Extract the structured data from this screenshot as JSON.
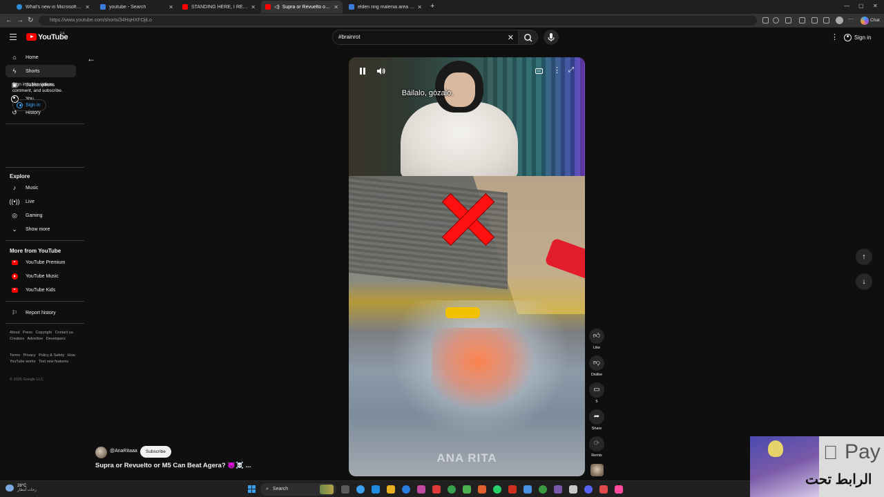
{
  "browser": {
    "tabs": [
      {
        "label": "What's new in Microsoft Edge",
        "active": false,
        "favicon_color": "#2a8fd6"
      },
      {
        "label": "youtube - Search",
        "active": false,
        "favicon_color": "#3b7bd9"
      },
      {
        "label": "STANDING HERE, I REALIZE but i...",
        "active": false,
        "favicon_color": "#ff0000"
      },
      {
        "label": "Supra or Revuelto or M5 Can...",
        "active": true,
        "favicon_color": "#ff0000"
      },
      {
        "label": "elden ring malenia area - Search",
        "active": false,
        "favicon_color": "#3b7bd9"
      }
    ],
    "new_tab": "+",
    "url": "https://www.youtube.com/shorts/34HqHXFOjiLo"
  },
  "yt_header": {
    "logo_text": "YouTube",
    "country_code": "SA",
    "search_query": "#brainrot",
    "sign_in_label": "Sign in"
  },
  "sidebar": {
    "main_items": [
      {
        "label": "Home",
        "icon": "home-icon",
        "active": false
      },
      {
        "label": "Shorts",
        "icon": "shorts-icon",
        "active": true
      },
      {
        "label": "Subscriptions",
        "icon": "subscriptions-icon",
        "active": false
      },
      {
        "label": "You",
        "icon": "you-icon",
        "active": false
      },
      {
        "label": "History",
        "icon": "history-icon",
        "active": false
      }
    ],
    "sign_in_prompt": "Sign in to like videos, comment, and subscribe.",
    "sign_in_button": "Sign in",
    "explore_heading": "Explore",
    "explore_items": [
      {
        "label": "Music",
        "icon": "music-icon"
      },
      {
        "label": "Live",
        "icon": "live-icon"
      },
      {
        "label": "Gaming",
        "icon": "gaming-icon"
      },
      {
        "label": "Show more",
        "icon": "chevron-down-icon"
      }
    ],
    "more_heading": "More from YouTube",
    "more_items": [
      {
        "label": "YouTube Premium",
        "icon": "youtube-premium-icon"
      },
      {
        "label": "YouTube Music",
        "icon": "youtube-music-icon"
      },
      {
        "label": "YouTube Kids",
        "icon": "youtube-kids-icon"
      }
    ],
    "report_history": "Report history",
    "footer_links_1": [
      "About",
      "Press",
      "Copyright",
      "Contact us",
      "Creators",
      "Advertise",
      "Developers"
    ],
    "footer_links_2": [
      "Terms",
      "Privacy",
      "Policy & Safety",
      "How YouTube works",
      "Test new features"
    ],
    "copyright": "© 2026 Google LLC"
  },
  "short": {
    "caption": "Báilalo, gózalo.",
    "watermark": "ANA RITA",
    "channel_name": "@AnaRitaaa",
    "subscribe_label": "Subscribe",
    "title": "Supra or Revuelto or M5 Can Beat Agera? 👿☠️ ...",
    "cc_label": "CC"
  },
  "actions": {
    "like_label": "Like",
    "dislike_label": "Dislike",
    "comment_count": "5",
    "share_label": "Share",
    "remix_label": "Remix"
  },
  "overlay": {
    "pay_text": "Pay",
    "arabic_text": "الرابط تحت"
  },
  "taskbar": {
    "weather_temp": "28°C",
    "weather_text": "زخات أمطار",
    "search_label": "Search",
    "app_colors": [
      "#5a5a5a",
      "#3aa0f0",
      "#1e8ae0",
      "#e8b020",
      "#2a7de0",
      "#c04aa0",
      "#e03a3a",
      "#3aa050",
      "#4caf50",
      "#e06030",
      "#25d366",
      "#d03020",
      "#4a90e0",
      "#3a9a40",
      "#7a5aa8",
      "#c8c8c8",
      "#5865f2",
      "#e04a4a",
      "#ff4aa0"
    ]
  }
}
